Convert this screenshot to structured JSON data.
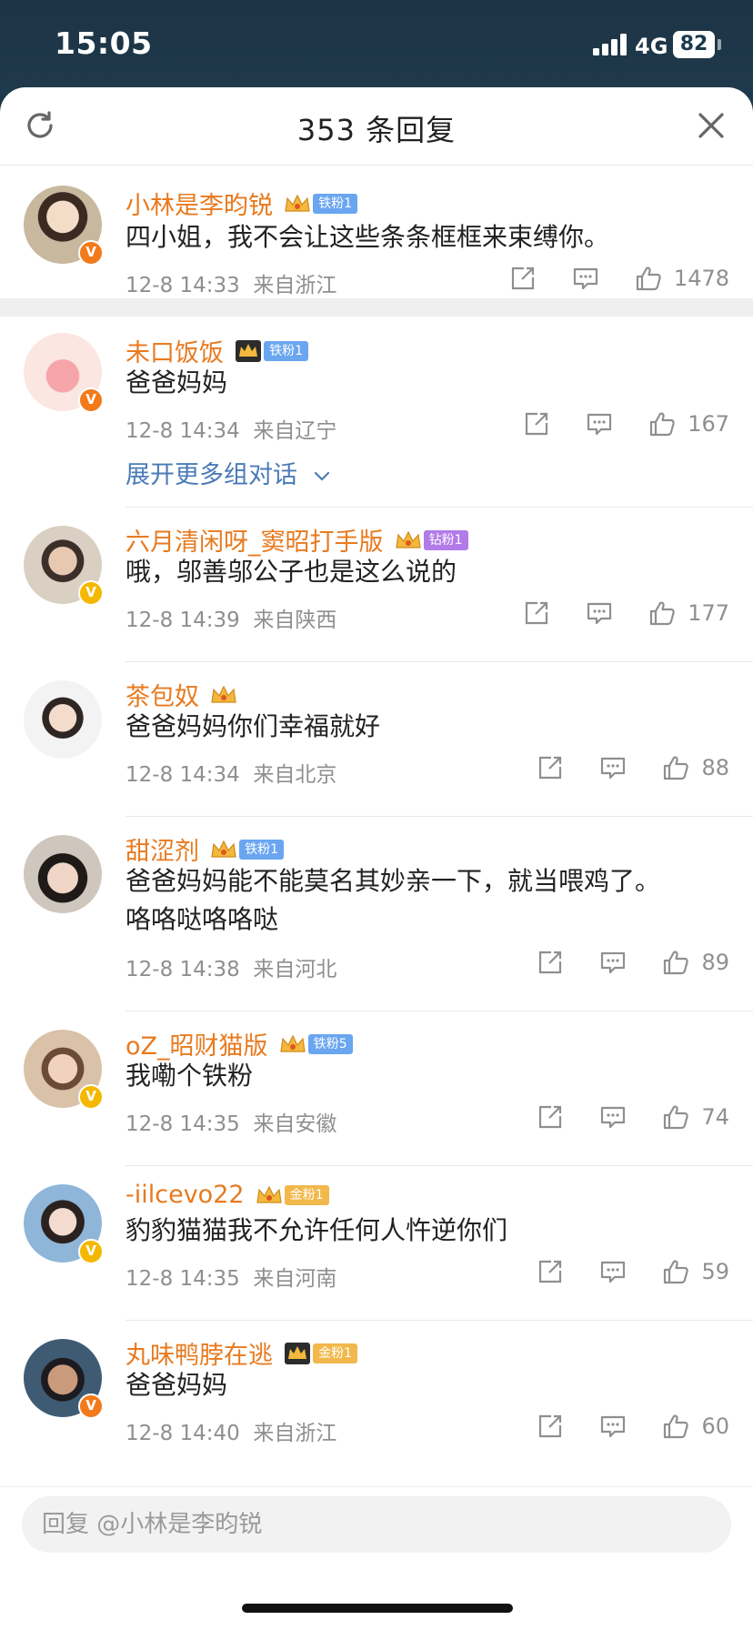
{
  "status_bar": {
    "time": "15:05",
    "network": "4G",
    "battery": "82"
  },
  "header": {
    "title": "353 条回复"
  },
  "main_comment": {
    "user": "小林是李昀锐",
    "fan_badge": "铁粉1",
    "text": "四小姐，我不会让这些条条框框来束缚你。",
    "time": "12-8 14:33",
    "location": "来自浙江",
    "likes": "1478"
  },
  "replies": [
    {
      "user": "未口饭饭",
      "fan_badge": "铁粉1",
      "text": "爸爸妈妈",
      "time": "12-8 14:34",
      "location": "来自辽宁",
      "likes": "167",
      "expand": "展开更多组对话"
    },
    {
      "user": "六月清闲呀_窦昭打手版",
      "fan_badge": "钻粉1",
      "text": "哦，邬善邬公子也是这么说的",
      "time": "12-8 14:39",
      "location": "来自陕西",
      "likes": "177"
    },
    {
      "user": "茶包奴",
      "fan_badge": "",
      "text": "爸爸妈妈你们幸福就好",
      "time": "12-8 14:34",
      "location": "来自北京",
      "likes": "88"
    },
    {
      "user": "甜涩剂",
      "fan_badge": "铁粉1",
      "text": "爸爸妈妈能不能莫名其妙亲一下，就当喂鸡了。",
      "text2": "咯咯哒咯咯哒",
      "time": "12-8 14:38",
      "location": "来自河北",
      "likes": "89"
    },
    {
      "user": "oZ_昭财猫版",
      "fan_badge": "铁粉5",
      "text": "我嘞个铁粉",
      "time": "12-8 14:35",
      "location": "来自安徽",
      "likes": "74"
    },
    {
      "user": "-iilcevo22",
      "fan_badge": "金粉1",
      "text": "豹豹猫猫我不允许任何人忤逆你们",
      "time": "12-8 14:35",
      "location": "来自河南",
      "likes": "59"
    },
    {
      "user": "丸味鸭脖在逃",
      "fan_badge": "金粉1",
      "text": "爸爸妈妈",
      "time": "12-8 14:40",
      "location": "来自浙江",
      "likes": "60"
    }
  ],
  "reply_input": {
    "placeholder": "回复 @小林是李昀锐"
  },
  "colors": {
    "name": "#e87a1f",
    "link": "#4a7bb7",
    "meta": "#8f8f8f",
    "iron_fan": "#6aa6f0",
    "diamond_fan": "#b27be8",
    "gold_fan": "#f2b84b"
  },
  "icons": [
    "refresh-icon",
    "close-icon",
    "repost-icon",
    "comment-icon",
    "like-icon",
    "crown-icon",
    "verified-badge-icon",
    "chevron-down-icon"
  ]
}
